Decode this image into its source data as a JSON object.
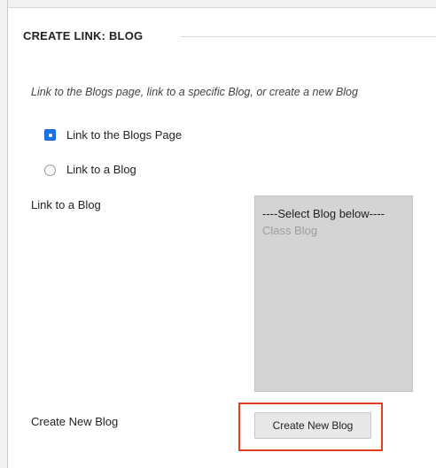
{
  "form": {
    "section_title": "CREATE LINK: BLOG",
    "instructions": "Link to the Blogs page, link to a specific Blog, or create a new Blog",
    "radio_options": [
      {
        "label": "Link to the Blogs Page",
        "checked": true
      },
      {
        "label": "Link to a Blog",
        "checked": false
      }
    ],
    "blog_select": {
      "label": "Link to a Blog",
      "options": [
        "----Select Blog below----",
        "Class Blog"
      ]
    },
    "create_new": {
      "label": "Create New Blog",
      "button_label": "Create New Blog"
    }
  },
  "colors": {
    "accent": "#1a73e8",
    "highlight": "#e0401f",
    "listbox_bg": "#d4d4d4"
  }
}
